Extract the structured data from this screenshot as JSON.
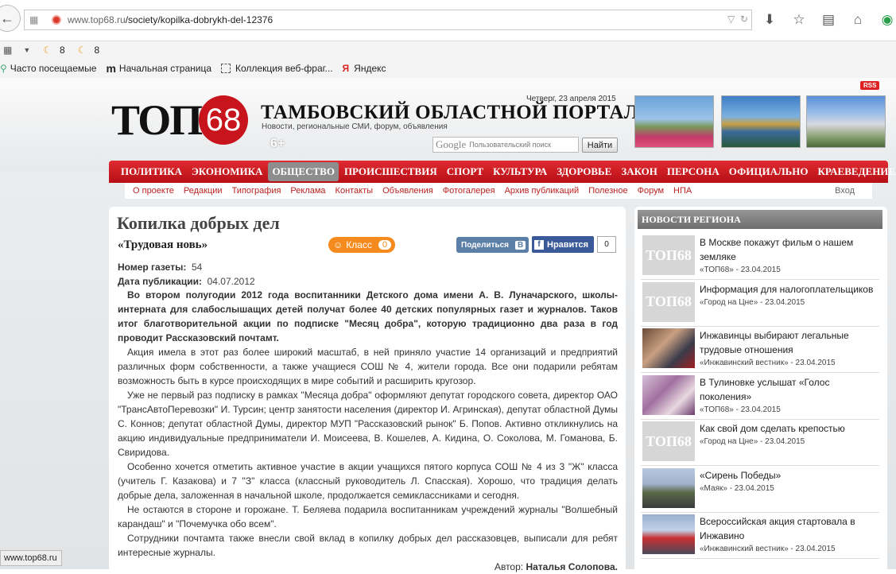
{
  "browser": {
    "url_domain": "www.top68.ru",
    "url_path": "/society/kopilka-dobrykh-del-12376",
    "toolbar": {
      "weather1": "8",
      "weather2": "8"
    },
    "bookmarks": [
      "Часто посещаемые",
      "Начальная страница",
      "Коллекция веб-фраг...",
      "Яндекс"
    ],
    "status_url": "www.top68.ru"
  },
  "site": {
    "rss": "RSS",
    "date": "Четверг, 23 апреля 2015",
    "logo_text": "ТОП",
    "logo_num": "68",
    "portal_title": "ТАМБОВСКИЙ ОБЛАСТНОЙ ПОРТАЛ",
    "tagline": "Новости, региональные СМИ, форум, объявления",
    "age": "6+",
    "search_placeholder": "Пользовательский поиск",
    "search_button": "Найти",
    "google": "Google"
  },
  "main_nav": [
    "ПОЛИТИКА",
    "ЭКОНОМИКА",
    "ОБЩЕСТВО",
    "ПРОИСШЕСТВИЯ",
    "СПОРТ",
    "КУЛЬТУРА",
    "ЗДОРОВЬЕ",
    "ЗАКОН",
    "ПЕРСОНА",
    "ОФИЦИАЛЬНО",
    "КРАЕВЕДЕНИЕ"
  ],
  "sub_nav": [
    "О проекте",
    "Редакции",
    "Типография",
    "Реклама",
    "Контакты",
    "Объявления",
    "Фотогалерея",
    "Архив публикаций",
    "Полезное",
    "Форум",
    "НПА"
  ],
  "login": "Вход",
  "article": {
    "title": "Копилка добрых дел",
    "paper": "«Трудовая новь»",
    "ok_label": "Класс",
    "ok_count": "0",
    "vk_label": "Поделиться",
    "vk_badge": "В",
    "fb_label": "Нравится",
    "fb_count": "0",
    "issue_label": "Номер газеты:",
    "issue_value": "54",
    "pub_label": "Дата публикации:",
    "pub_value": "04.07.2012",
    "lead": "Во втором полугодии 2012 года воспитанники Детского дома имени А. В. Луначарского, школы-интерната для слабослышащих детей получат более 40 детских популярных газет и журналов. Таков итог благотворительной акции по подписке \"Месяц добра\", которую традиционно два раза в год проводит Рассказовский почтамт.",
    "p1": "Акция имела в этот раз более широкий масштаб, в ней приняло участие 14 организаций и предприятий различных форм собственности, а также учащиеся СОШ № 4, жители города. Все они подарили ребятам возможность быть в курсе происходящих в мире событий и расширить  кругозор.",
    "p2": "Уже не первый раз подписку в рамках \"Месяца добра\" оформляют депутат городского совета, директор ОАО \"ТрансАвтоПеревозки\" И. Турсин; центр занятости населения (директор И. Агринская), депутат областной Думы      С. Коннов; депутат областной Думы, директор МУП \"Рассказовский рынок\" Б. Попов. Активно откликнулись на акцию  индивидуальные предприниматели И. Моисеева, В. Кошелев, А. Кидина, О. Соколова, М. Гоманова, Б. Свиридова.",
    "p3": "Особенно хочется отметить активное участие в акции учащихся пятого корпуса СОШ    № 4 из 3 \"Ж\" класса (учитель Г. Казакова) и       7 \"З\" класса (классный руководитель Л. Спасская). Хорошо, что традиция делать добрые дела, заложенная в начальной школе, продолжается семиклассниками и сегодня.",
    "p4": "Не остаются в стороне и горожане. Т. Беляева подарила воспитанникам учреждений журналы \"Волшебный карандаш\" и \"Почемучка обо всем\".",
    "p5": "Сотрудники почтамта также внесли свой вклад в копилку добрых дел рассказовцев, выписали для ребят интересные журналы.",
    "author_label": "Автор:",
    "author_name": "Наталья Солопова."
  },
  "sidebar": {
    "heading": "НОВОСТИ РЕГИОНА",
    "items": [
      {
        "title": "В Москве покажут фильм о нашем земляке",
        "source": "«ТОП68» - 23.04.2015",
        "thumb": "logo",
        "thumb_text": "ТОП68"
      },
      {
        "title": "Информация для налогоплательщиков",
        "source": "«Город на Цне» - 23.04.2015",
        "thumb": "logo",
        "thumb_text": "ТОП68"
      },
      {
        "title": "Инжавинцы выбирают легальные трудовые отношения",
        "source": "«Инжавинский вестник» - 23.04.2015",
        "thumb": "photo"
      },
      {
        "title": "В Тулиновке услышат «Голос поколения»",
        "source": "«ТОП68» - 23.04.2015",
        "thumb": "photo"
      },
      {
        "title": "Как свой дом сделать крепостью",
        "source": "«Город на Цне» - 23.04.2015",
        "thumb": "logo",
        "thumb_text": "ТОП68"
      },
      {
        "title": "«Сирень Победы»",
        "source": "«Маяк» - 23.04.2015",
        "thumb": "photo"
      },
      {
        "title": "Всероссийская акция стартовала в Инжавино",
        "source": "«Инжавинский вестник» - 23.04.2015",
        "thumb": "photo"
      }
    ]
  },
  "colors": {
    "brand_red": "#c8141c",
    "nav_active": "#8d8d8d",
    "link_red": "#b22"
  }
}
